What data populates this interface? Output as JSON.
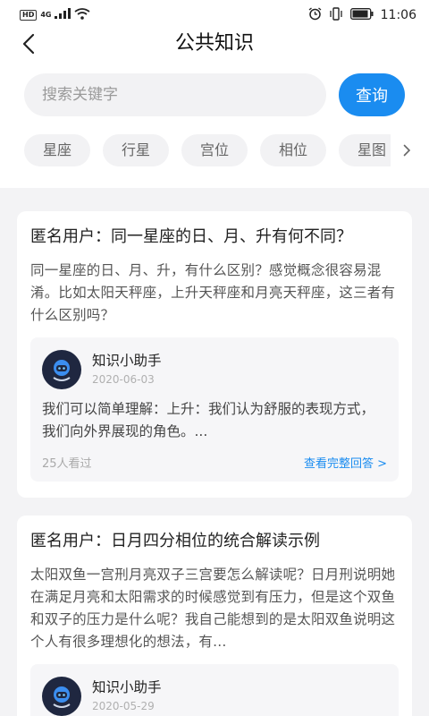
{
  "status_bar": {
    "hd_badge": "HD",
    "network": "4G",
    "time": "11:06"
  },
  "header": {
    "title": "公共知识"
  },
  "search": {
    "placeholder": "搜索关键字",
    "button_label": "查询"
  },
  "categories": [
    "星座",
    "行星",
    "宫位",
    "相位",
    "星图"
  ],
  "questions": [
    {
      "title": "匿名用户：同一星座的日、月、升有何不同？",
      "description": "同一星座的日、月、升，有什么区别？感觉概念很容易混淆。比如太阳天秤座，上升天秤座和月亮天秤座，这三者有什么区别吗？",
      "answer": {
        "author": "知识小助手",
        "date": "2020-06-03",
        "text": "我们可以简单理解：上升：我们认为舒服的表现方式，我们向外界展现的角色。...",
        "views": "25人看过",
        "link_label": "查看完整回答 >"
      }
    },
    {
      "title": "匿名用户：日月四分相位的统合解读示例",
      "description": "太阳双鱼一宫刑月亮双子三宫要怎么解读呢？日月刑说明她在满足月亮和太阳需求的时候感觉到有压力，但是这个双鱼和双子的压力是什么呢？我自己能想到的是太阳双鱼说明这个人有很多理想化的想法，有...",
      "answer": {
        "author": "知识小助手",
        "date": "2020-05-29"
      }
    }
  ],
  "colors": {
    "accent": "#1a8cf0",
    "background": "#f3f3f5"
  }
}
